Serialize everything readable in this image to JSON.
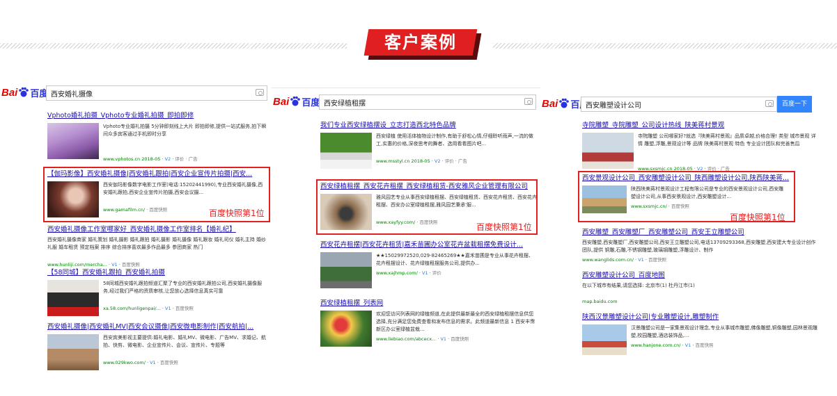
{
  "header": {
    "title": "客户案例"
  },
  "panels": [
    {
      "logo": {
        "bai": "Bai",
        "du": "百度"
      },
      "query": "西安婚礼摄像",
      "rank_label": "百度快照第1位",
      "results": [
        {
          "title": "Vphoto婚礼拍摄_Vphoto专业婚礼拍摄_即拍即修",
          "desc": "Vphoto专业婚礼拍摄 5分钟即刻线上大片 即拍即修,提供一站式服务,拍下瞬间众多宾客通过手机即时分享",
          "url": "www.vphotos.cn  2018-05",
          "v": "V2",
          "snap": "评价 · 广告"
        },
        {
          "title": "【伽玛影像】西安婚礼摄像|西安婚礼跟拍|西安企业宣传片拍摄|西安...",
          "desc": "西安伽玛影像数字电影工作室(电话:15202441990),专业西安婚礼摄像,西安婚礼跟拍,西安企业宣传片拍摄,西安会议摄...",
          "url": "www.gamafilm.cn/",
          "v": "",
          "snap": "百度快照"
        },
        {
          "title": "西安婚礼摄像工作室哪家好_西安婚礼摄像工作室排名【婚礼纪】",
          "desc": "西安婚礼摄像商家 婚礼策划 婚礼摄影 婚礼跟拍 婚礼摄影 婚礼摄像 婚礼跟妆 婚礼司仪 婚礼主持 婚纱礼服 婚车租赁 预定档案 排序 综合排序喜欢最多作品最多 参团商家 热门",
          "url": "www.hunliji.com/mercha...",
          "v": "V1",
          "snap": "百度快照"
        },
        {
          "title": "【58同城】西安婚礼跟拍_西安婚礼拍摄",
          "desc": "58同城西安婚礼跟拍频道汇聚了专业的西安婚礼跟拍公司,西安婚礼摄像服务,经过我们严格的资质审核,让您放心选择信息真实可靠",
          "url": "xa.58.com/hunligenpai/...",
          "v": "V1",
          "snap": "百度快照"
        },
        {
          "title": "西安婚礼摄像|西安婚礼MV|西安会议摄像|西安微电影制作|西安航拍|...",
          "desc": "西安宾美影视主要提供:婚礼电影、婚礼MV、微电影、广告MV、求婚记、航拍、快剪、微电影、企业宣传片、会议、宣传片、专题等",
          "url": "www.029kwo.com/",
          "v": "V1",
          "snap": "百度快照"
        }
      ]
    },
    {
      "logo": {
        "bai": "Bai",
        "du": "百度"
      },
      "query": "西安绿植租摆",
      "rank_label": "百度快照第1位",
      "results": [
        {
          "title": "我们专业西安绿植摆设_立志打造西北特色品牌",
          "desc": "西安绿植 使用活体植物设计制作,有助于舒松心情,仔细聆听雨声,一流的做工,实惠的价格,深夜思考的舞者、选用看看图片吧...",
          "url": "www.msstyl.cn  2018-05",
          "v": "V2",
          "snap": "评价 · 广告"
        },
        {
          "title": "西安绿植租摆_西安花卉租摆_西安绿植租赁-西安雅风企业管理有限公司",
          "desc": "雅风园艺专业从事西安绿植租摆、西安绿植租赁、西安花卉租赁、西安花卉租摆、西安办公室绿植租摆,雅风园艺秉承'服...",
          "url": "www.xayfyy.com/",
          "v": "",
          "snap": "百度快照"
        },
        {
          "title": "西安花卉租摆|西安花卉租赁|嘉禾苗圃办公室花卉盆栽租摆免费设计...",
          "desc": "★★15029972520,029-82465269★★嘉禾苗圃是专业从事花卉租摆、花卉租摆设计、花卉绿植租摆服务公司,提供办...",
          "url": "www.xajhmp.com/",
          "v": "V1",
          "snap": "评价"
        },
        {
          "title": "西安绿植租摆_列表网",
          "desc": "欢迎您访问列表网的绿植频道,在此提供最新最全的西安绿植租摆信息供您选择,充分满足您免费查看和发布信息的需求。此频道最新信息 1 西安丰霈新区办公室绿植盆栽...",
          "url": "www.liebiao.com/abcecx...",
          "v": "V1",
          "snap": "百度快照"
        }
      ]
    },
    {
      "logo": {
        "bai": "Bai",
        "du": "百度"
      },
      "query": "西安雕塑设计公司",
      "button": "百度一下",
      "rank_label": "百度快照第1位",
      "results": [
        {
          "title": "寺院雕塑_寺院雕塑_公司设计热线_陕美蒋村景观",
          "desc": "寺院雕塑 公司哪家好?就选『陕美蒋村景观』品质卓越,价格合理! 类型 城市景观 详情 雕塑,浮雕,景观设计等 品牌 陕美蒋村景观 特色 专业设计团队和完善售后",
          "url": "www.sxsmjc.cn  2018-05",
          "v": "V2",
          "snap": "评价 · 广告"
        },
        {
          "title": "西安景观设计公司_西安雕塑设计公司_陕西雕塑设计公司,陕西陕美蒋...",
          "desc": "陕西陕美蒋村景观设计工程有限公司是专业的西安景观设计公司,西安雕塑设计公司,从事西安景观设计,西安雕塑设计...",
          "url": "www.sxsmjc.cn/",
          "v": "",
          "snap": "百度快照"
        },
        {
          "title": "西安雕塑_西安雕塑厂_西安雕塑公司_西安王立雕塑公司",
          "desc": "西安雕塑,西安雕塑厂,西安雕塑公司,西安王立雕塑公司,电话13709293368,西安雕塑,西安建大专业设计创作团队,提供 铜雕,石雕,不锈钢雕塑,玻璃钢雕塑,浮雕设计、制作",
          "url": "www.wanglids.com.cn/",
          "v": "V1",
          "snap": "百度快照"
        },
        {
          "title": "西安雕塑设计公司_百度地图",
          "desc": "在以下城市有结果,请您选择: 北京市(1) 杜丹江市(1)",
          "url": "map.baidu.com",
          "v": "",
          "snap": ""
        },
        {
          "title": "陕西汉景雕塑设计公司|专业雕塑设计,雕塑制作",
          "desc": "汉景雕塑公司是一家集景观设计理念,专业从事城市雕塑,佛像雕塑,铜像雕塑,园林景观雕塑,校园雕塑,酒店装饰品,...",
          "url": "www.hanjone.com.cn/",
          "v": "V1",
          "snap": "百度快照"
        }
      ]
    }
  ]
}
